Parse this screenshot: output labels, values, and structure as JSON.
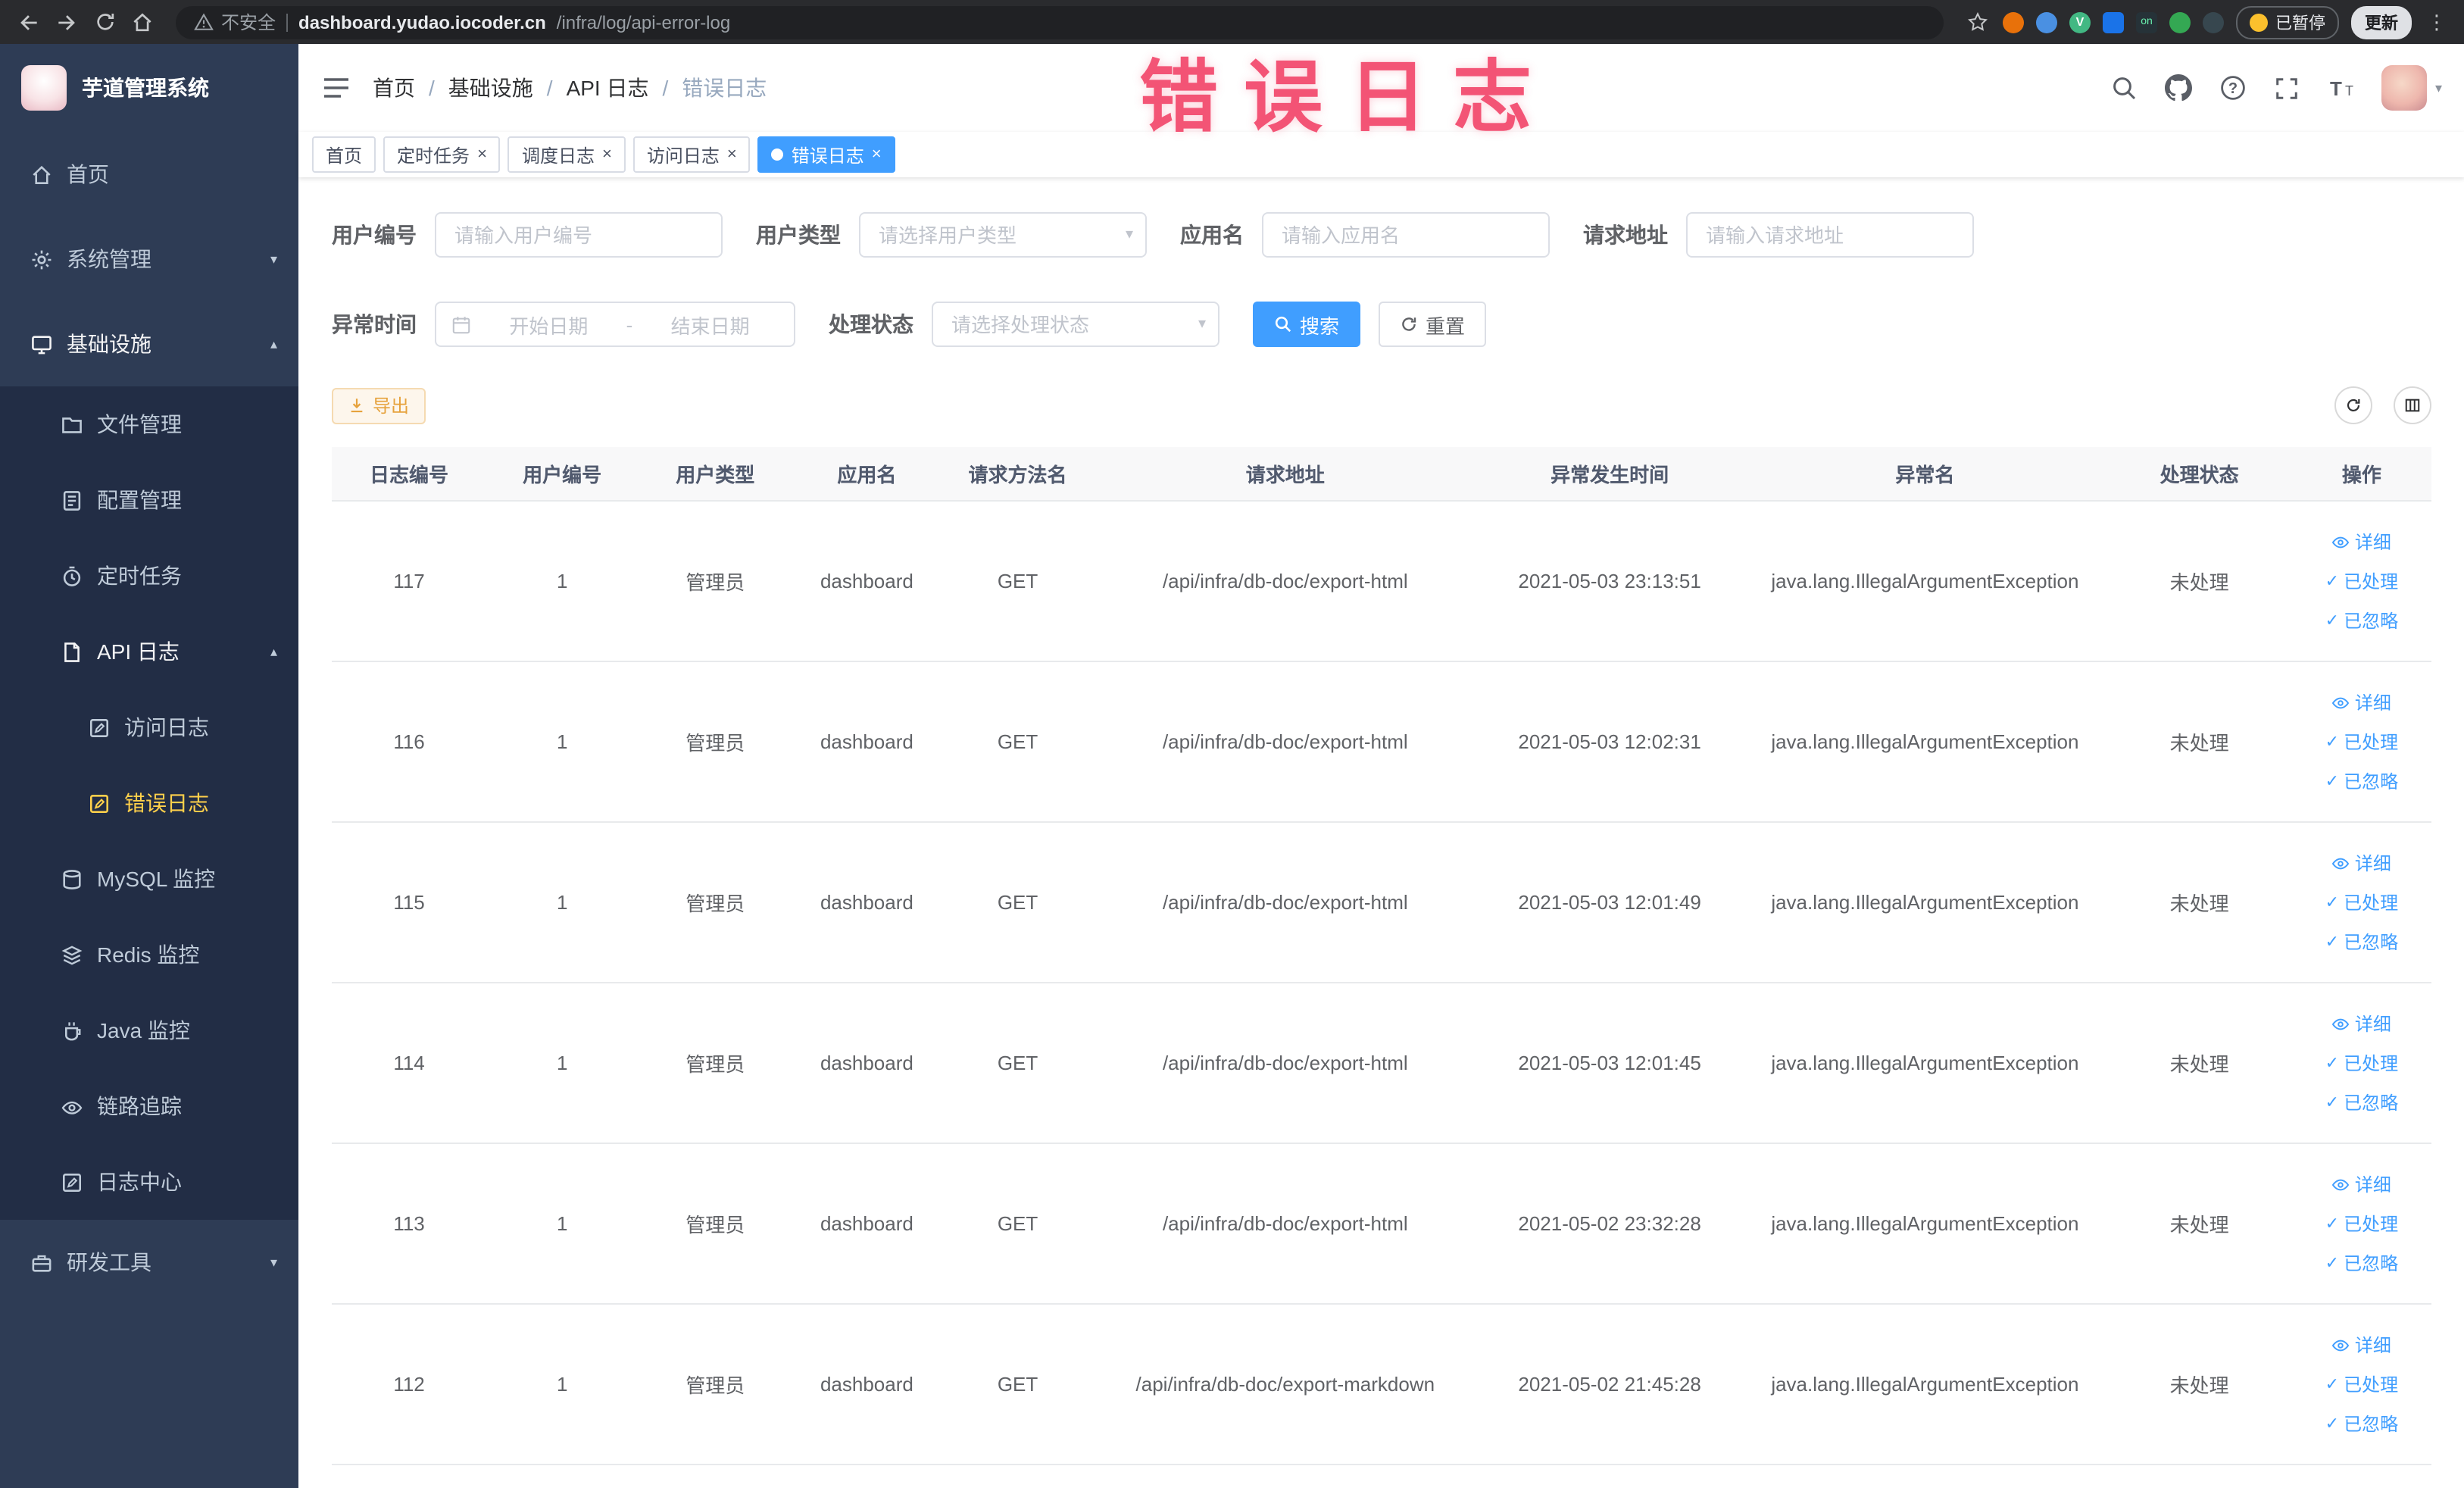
{
  "annotation": {
    "text": "错误日志"
  },
  "glyphs": {
    "close": "×",
    "caret_down": "▾",
    "caret_up": "▴",
    "kebab": "⋮",
    "slash": "/",
    "check": "✓",
    "v_chip": "V",
    "on_chip": "on"
  },
  "colors": {
    "primary": "#409eff",
    "active_menu": "#ffd04b",
    "warning": "#e6a23c",
    "annotation": "#f2486b"
  },
  "browser": {
    "security_label": "不安全",
    "url_host": "dashboard.yudao.iocoder.cn",
    "url_path": "/infra/log/api-error-log",
    "paused_badge": "已暂停",
    "update_button": "更新"
  },
  "sidebar": {
    "logo_title": "芋道管理系统",
    "home": "首页",
    "system": "系统管理",
    "infra": "基础设施",
    "file": "文件管理",
    "config": "配置管理",
    "job": "定时任务",
    "api_log": "API 日志",
    "access_log": "访问日志",
    "error_log": "错误日志",
    "mysql": "MySQL 监控",
    "redis": "Redis 监控",
    "java": "Java 监控",
    "trace": "链路追踪",
    "log_center": "日志中心",
    "dev_tools": "研发工具"
  },
  "breadcrumb": {
    "items": [
      "首页",
      "基础设施",
      "API 日志",
      "错误日志"
    ]
  },
  "tabs": {
    "home": "首页",
    "job": "定时任务",
    "job_log": "调度日志",
    "access_log": "访问日志",
    "error_log": "错误日志"
  },
  "filters": {
    "user_id": {
      "label": "用户编号",
      "placeholder": "请输入用户编号"
    },
    "user_type": {
      "label": "用户类型",
      "placeholder": "请选择用户类型"
    },
    "app_name": {
      "label": "应用名",
      "placeholder": "请输入应用名"
    },
    "request_url": {
      "label": "请求地址",
      "placeholder": "请输入请求地址"
    },
    "exception_time": {
      "label": "异常时间",
      "start_placeholder": "开始日期",
      "separator": "-",
      "end_placeholder": "结束日期"
    },
    "process_status": {
      "label": "处理状态",
      "placeholder": "请选择处理状态"
    },
    "search_button": "搜索",
    "reset_button": "重置"
  },
  "toolbar": {
    "export_button": "导出"
  },
  "table": {
    "columns": [
      "日志编号",
      "用户编号",
      "用户类型",
      "应用名",
      "请求方法名",
      "请求地址",
      "异常发生时间",
      "异常名",
      "处理状态",
      "操作"
    ],
    "action_labels": {
      "detail": "详细",
      "processed": "已处理",
      "ignored": "已忽略"
    },
    "rows": [
      {
        "id": "117",
        "user_id": "1",
        "user_type": "管理员",
        "app": "dashboard",
        "method": "GET",
        "url": "/api/infra/db-doc/export-html",
        "time": "2021-05-03 23:13:51",
        "exception": "java.lang.IllegalArgumentException",
        "status": "未处理"
      },
      {
        "id": "116",
        "user_id": "1",
        "user_type": "管理员",
        "app": "dashboard",
        "method": "GET",
        "url": "/api/infra/db-doc/export-html",
        "time": "2021-05-03 12:02:31",
        "exception": "java.lang.IllegalArgumentException",
        "status": "未处理"
      },
      {
        "id": "115",
        "user_id": "1",
        "user_type": "管理员",
        "app": "dashboard",
        "method": "GET",
        "url": "/api/infra/db-doc/export-html",
        "time": "2021-05-03 12:01:49",
        "exception": "java.lang.IllegalArgumentException",
        "status": "未处理"
      },
      {
        "id": "114",
        "user_id": "1",
        "user_type": "管理员",
        "app": "dashboard",
        "method": "GET",
        "url": "/api/infra/db-doc/export-html",
        "time": "2021-05-03 12:01:45",
        "exception": "java.lang.IllegalArgumentException",
        "status": "未处理"
      },
      {
        "id": "113",
        "user_id": "1",
        "user_type": "管理员",
        "app": "dashboard",
        "method": "GET",
        "url": "/api/infra/db-doc/export-html",
        "time": "2021-05-02 23:32:28",
        "exception": "java.lang.IllegalArgumentException",
        "status": "未处理"
      },
      {
        "id": "112",
        "user_id": "1",
        "user_type": "管理员",
        "app": "dashboard",
        "method": "GET",
        "url": "/api/infra/db-doc/export-markdown",
        "time": "2021-05-02 21:45:28",
        "exception": "java.lang.IllegalArgumentException",
        "status": "未处理"
      }
    ]
  }
}
